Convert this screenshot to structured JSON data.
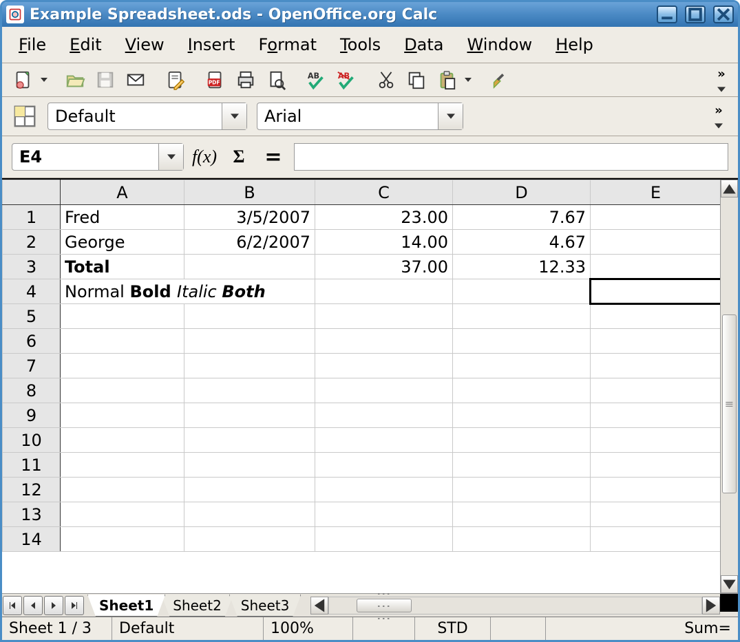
{
  "window": {
    "title": "Example Spreadsheet.ods - OpenOffice.org Calc"
  },
  "menu": {
    "file": "File",
    "edit": "Edit",
    "view": "View",
    "insert": "Insert",
    "format": "Format",
    "tools": "Tools",
    "data": "Data",
    "window": "Window",
    "help": "Help"
  },
  "format_toolbar": {
    "style": "Default",
    "font": "Arial"
  },
  "formula_bar": {
    "cell_ref": "E4",
    "fx": "f(x)",
    "sum": "Σ",
    "eq": "=",
    "formula": ""
  },
  "columns": [
    "A",
    "B",
    "C",
    "D",
    "E"
  ],
  "row_numbers": [
    "1",
    "2",
    "3",
    "4",
    "5",
    "6",
    "7",
    "8",
    "9",
    "10",
    "11",
    "12",
    "13",
    "14"
  ],
  "selected": {
    "col": "E",
    "row": "4"
  },
  "cells": {
    "r1": {
      "A": "Fred",
      "B": "3/5/2007",
      "C": "23.00",
      "D": "7.67"
    },
    "r2": {
      "A": "George",
      "B": "6/2/2007",
      "C": "14.00",
      "D": "4.67"
    },
    "r3": {
      "A": "Total",
      "C": "37.00",
      "D": "12.33"
    },
    "r4": {
      "A_parts": {
        "normal": "Normal ",
        "bold": "Bold ",
        "italic": "Italic ",
        "both": "Both"
      }
    }
  },
  "sheet_tabs": {
    "s1": "Sheet1",
    "s2": "Sheet2",
    "s3": "Sheet3"
  },
  "status": {
    "sheet_pos": "Sheet 1 / 3",
    "page_style": "Default",
    "zoom": "100%",
    "mode": "STD",
    "sum": "Sum="
  }
}
